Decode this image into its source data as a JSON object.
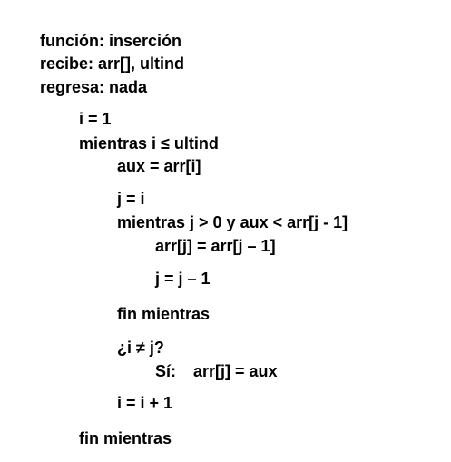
{
  "header": {
    "function_line": "función: inserción",
    "receives_line": "recibe: arr[], ultind",
    "returns_line": "regresa: nada"
  },
  "code": {
    "init": "i = 1",
    "outer_while": "mientras i ≤ ultind",
    "aux_assign": "aux = arr[i]",
    "j_assign": "j = i",
    "inner_while": "mientras j > 0 y aux < arr[j - 1]",
    "shift_assign": "arr[j] = arr[j – 1]",
    "j_decrement": "j = j – 1",
    "inner_end": "fin mientras",
    "condition": "¿i ≠ j?",
    "then_label": "Sí:",
    "then_assign": "arr[j] = aux",
    "i_increment": "i = i + 1",
    "outer_end": "fin mientras"
  }
}
